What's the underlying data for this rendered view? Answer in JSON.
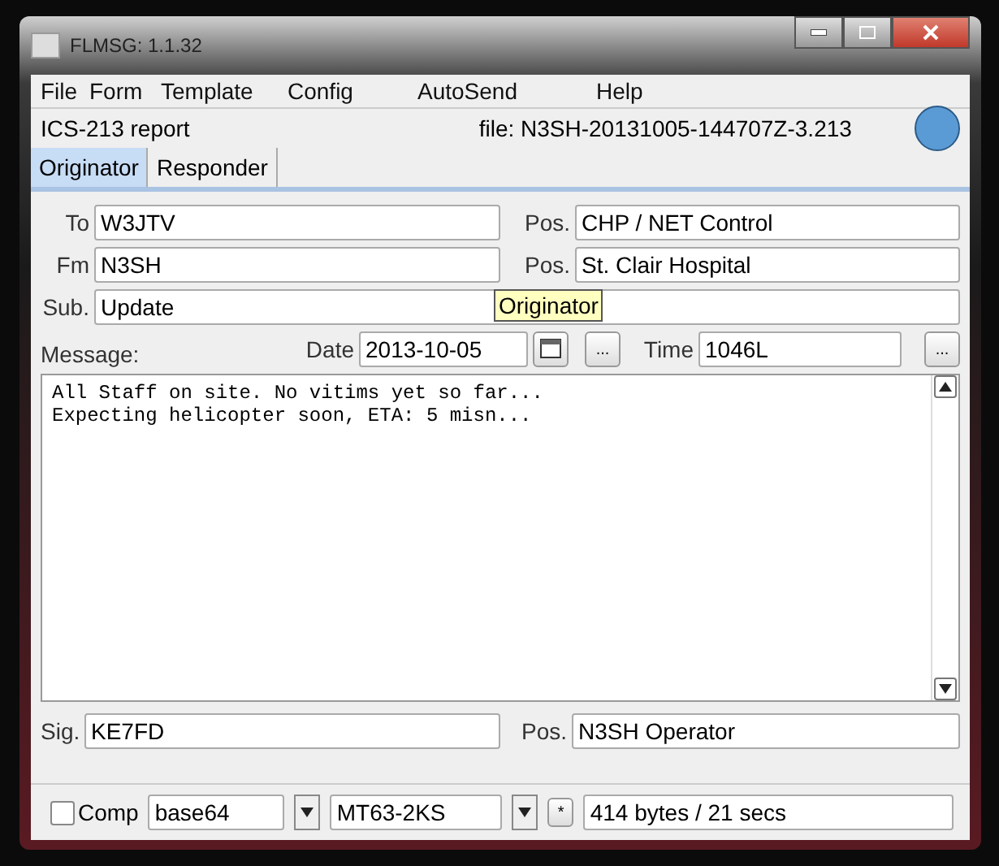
{
  "window": {
    "title": "FLMSG: 1.1.32"
  },
  "menu": [
    {
      "label": "File"
    },
    {
      "label": "Form"
    },
    {
      "label": "Template"
    },
    {
      "label": "Config"
    },
    {
      "label": "AutoSend"
    },
    {
      "label": "Help"
    }
  ],
  "info": {
    "form_name": "ICS-213 report",
    "file": "file: N3SH-20131005-144707Z-3.213"
  },
  "tabs": [
    {
      "label": "Originator",
      "selected": true
    },
    {
      "label": "Responder",
      "selected": false
    }
  ],
  "fields": {
    "to_label": "To",
    "to": "W3JTV",
    "to_pos_label": "Pos.",
    "to_pos": "CHP / NET Control",
    "fm_label": "Fm",
    "fm": "N3SH",
    "fm_pos_label": "Pos.",
    "fm_pos": "St. Clair Hospital",
    "sub_label": "Sub.",
    "sub": "Update",
    "date_label": "Date",
    "date": "2013-10-05",
    "time_label": "Time",
    "time": "1046L",
    "ellipsis": "...",
    "message_label": "Message:"
  },
  "tooltip": "Originator",
  "message": [
    "All Staff on site. No vitims yet so far...",
    "Expecting helicopter soon, ETA: 5 misn..."
  ],
  "signature": {
    "sig_label": "Sig.",
    "sig": "KE7FD",
    "pos_label": "Pos.",
    "pos": "N3SH Operator"
  },
  "bottom": {
    "comp_label": "Comp",
    "comp_checked": false,
    "encoding": "base64",
    "mode": "MT63-2KS",
    "star": "*",
    "size": "414 bytes / 21 secs"
  }
}
